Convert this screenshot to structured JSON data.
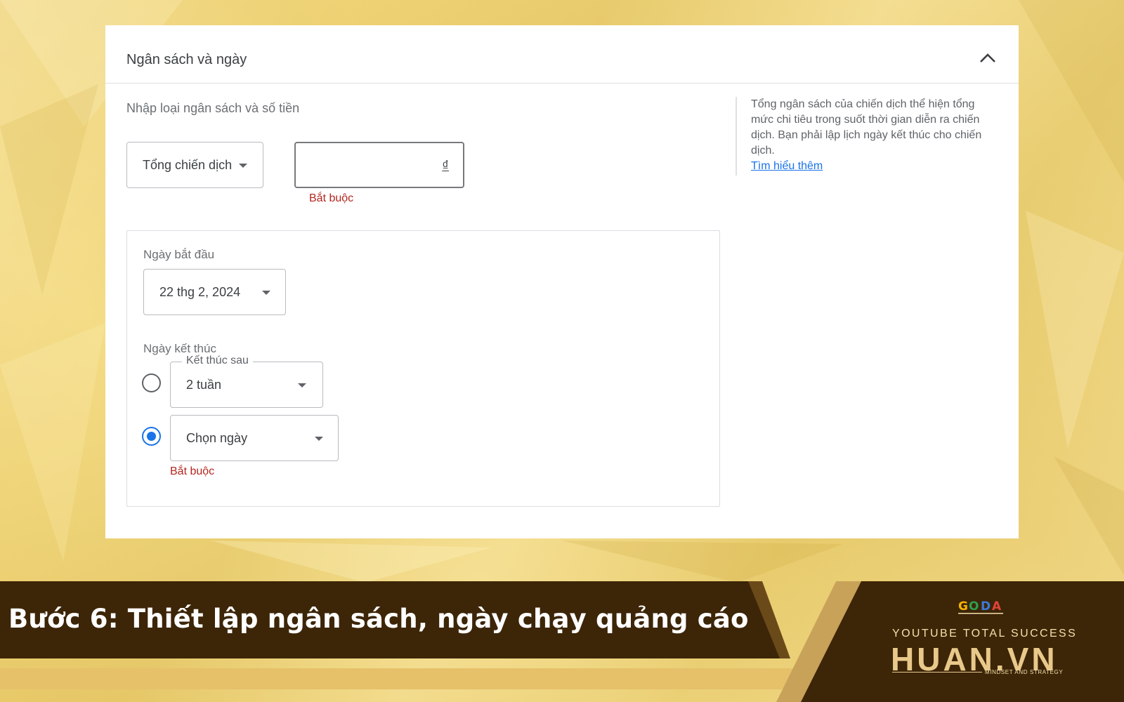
{
  "panel": {
    "title": "Ngân sách và ngày",
    "collapse_icon": "chevron-up-icon"
  },
  "budget": {
    "section_label": "Nhập loại ngân sách và số tiền",
    "type_value": "Tổng chiến dịch",
    "amount_value": "",
    "currency": "₫",
    "error": "Bắt buộc"
  },
  "help": {
    "text": "Tổng ngân sách của chiến dịch thể hiện tổng mức chi tiêu trong suốt thời gian diễn ra chiến dịch. Bạn phải lập lịch ngày kết thúc cho chiến dịch.",
    "link": "Tìm hiểu thêm"
  },
  "dates": {
    "start_label": "Ngày bắt đầu",
    "start_value": "22 thg 2, 2024",
    "end_label": "Ngày kết thúc",
    "end_after_label": "Kết thúc sau",
    "end_after_value": "2 tuần",
    "end_after_selected": false,
    "end_date_value": "Chọn ngày",
    "end_date_selected": true,
    "end_date_error": "Bắt buộc"
  },
  "banner": {
    "title": "Bước 6: Thiết lập ngân sách, ngày chạy quảng cáo",
    "logo_text": "GODA",
    "brand_sub": "YOUTUBE TOTAL SUCCESS",
    "brand_main": "HUAN.VN",
    "brand_tag": "MINDSET AND STRATEGY"
  },
  "colors": {
    "background": "#f1d679",
    "panel": "#ffffff",
    "accent_blue": "#1a73e8",
    "error_red": "#b3261e",
    "banner_dark": "#3d2508",
    "banner_gold": "#c9a25a"
  }
}
